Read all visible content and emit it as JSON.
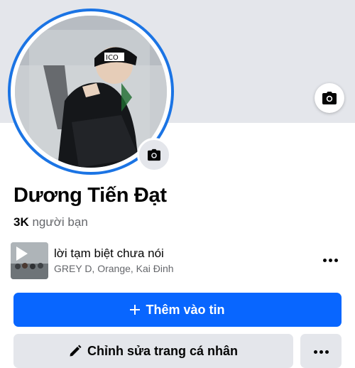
{
  "profile": {
    "name": "Dương Tiến Đạt",
    "friends_count": "3K",
    "friends_label": "người bạn"
  },
  "music": {
    "title": "lời tạm biệt chưa nói",
    "artists": "GREY D, Orange, Kai Đinh"
  },
  "actions": {
    "add_story_label": "Thêm vào tin",
    "edit_profile_label": "Chỉnh sửa trang cá nhân"
  },
  "icons": {
    "cover_camera": "camera-icon",
    "avatar_camera": "camera-icon",
    "music_more": "more-horizontal-icon",
    "add_story": "plus-icon",
    "edit_profile": "pencil-icon",
    "profile_more": "more-horizontal-icon"
  },
  "colors": {
    "primary_button": "#0866ff",
    "avatar_ring": "#1b74e4",
    "secondary_button": "#e4e6eb",
    "cover": "#e4e6eb"
  }
}
